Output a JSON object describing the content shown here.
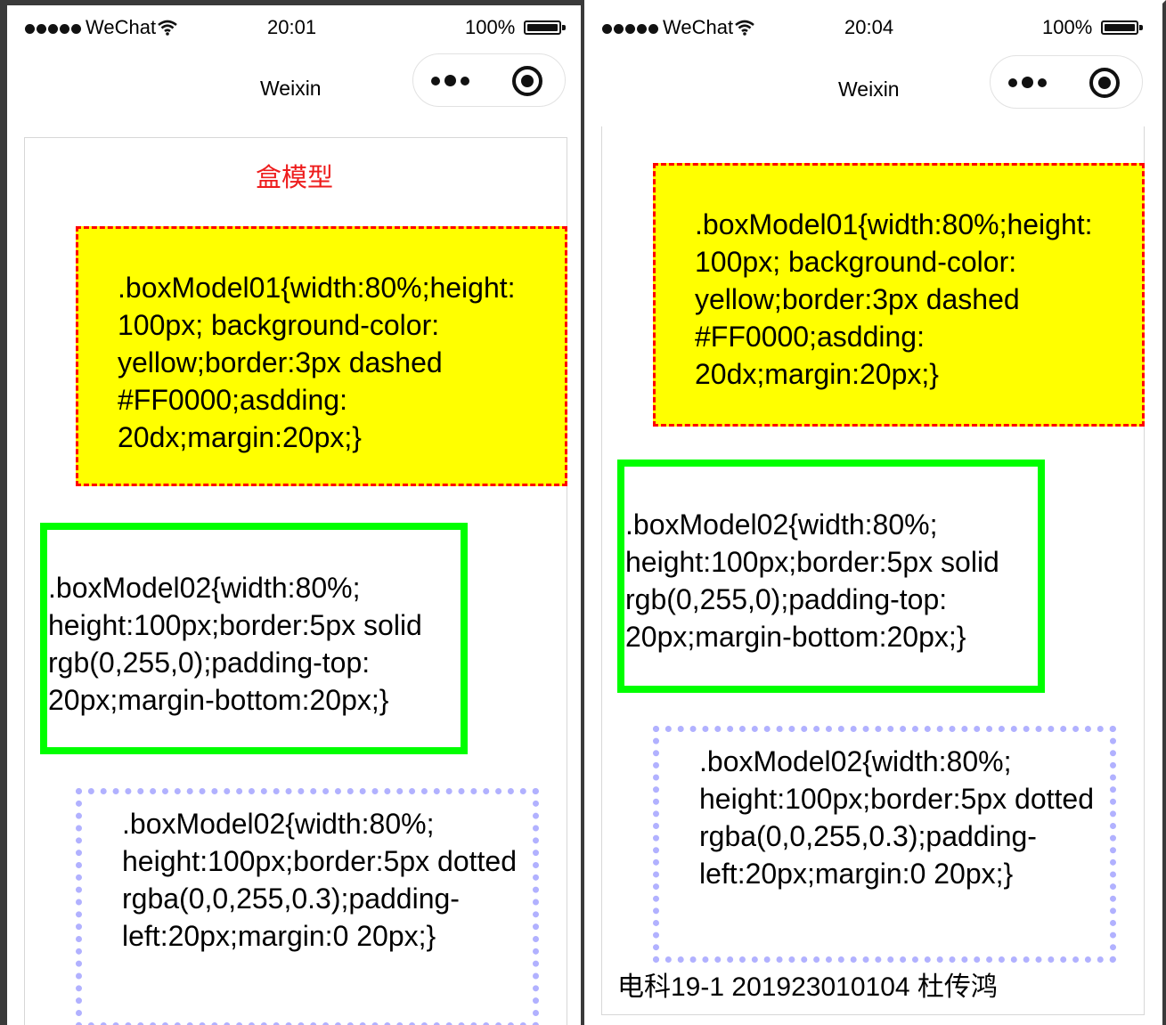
{
  "screens": [
    {
      "status": {
        "carrier": "WeChat",
        "time": "20:01",
        "battery": "100%"
      },
      "nav": {
        "title": "Weixin"
      },
      "heading": "盒模型",
      "box1_text": ".boxModel01{width:80%;height: 100px; background-color: yellow;border:3px dashed #FF0000;asdding: 20dx;margin:20px;}",
      "box2_text": ".boxModel02{width:80%; height:100px;border:5px solid rgb(0,255,0);padding-top: 20px;margin-bottom:20px;}",
      "box3_text": ".boxModel02{width:80%; height:100px;border:5px dotted rgba(0,0,255,0.3);padding-left:20px;margin:0 20px;}"
    },
    {
      "status": {
        "carrier": "WeChat",
        "time": "20:04",
        "battery": "100%"
      },
      "nav": {
        "title": "Weixin"
      },
      "box1_text": ".boxModel01{width:80%;height: 100px; background-color: yellow;border:3px dashed #FF0000;asdding: 20dx;margin:20px;}",
      "box2_text": ".boxModel02{width:80%; height:100px;border:5px solid rgb(0,255,0);padding-top: 20px;margin-bottom:20px;}",
      "box3_text": ".boxModel02{width:80%; height:100px;border:5px dotted rgba(0,0,255,0.3);padding-left:20px;margin:0 20px;}",
      "footer": "电科19-1 201923010104 杜传鸿"
    }
  ],
  "icons": {
    "signal": "signal-dots-icon",
    "wifi": "wifi-icon",
    "battery": "battery-icon",
    "more": "more-icon",
    "close": "close-icon"
  },
  "colors": {
    "heading": "#ee1c1c",
    "box1_bg": "#ffff00",
    "box1_border": "#ff0000",
    "box2_border": "#00ff00",
    "box3_border": "rgba(0,0,255,0.3)"
  }
}
